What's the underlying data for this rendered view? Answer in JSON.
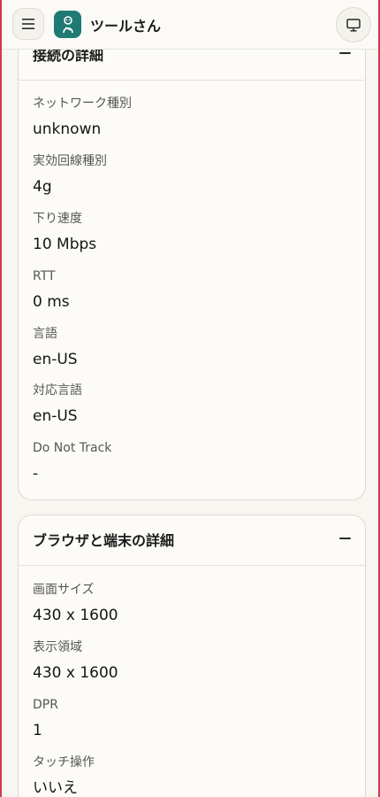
{
  "header": {
    "app_title": "ツールさん"
  },
  "connection_card": {
    "title": "接続の詳細",
    "fields": [
      {
        "label": "ネットワーク種別",
        "value": "unknown"
      },
      {
        "label": "実効回線種別",
        "value": "4g"
      },
      {
        "label": "下り速度",
        "value": "10 Mbps"
      },
      {
        "label": "RTT",
        "value": "0 ms"
      },
      {
        "label": "言語",
        "value": "en-US"
      },
      {
        "label": "対応言語",
        "value": "en-US"
      },
      {
        "label": "Do Not Track",
        "value": "-"
      }
    ]
  },
  "browser_card": {
    "title": "ブラウザと端末の詳細",
    "fields": [
      {
        "label": "画面サイズ",
        "value": "430 x 1600"
      },
      {
        "label": "表示領域",
        "value": "430 x 1600"
      },
      {
        "label": "DPR",
        "value": "1"
      },
      {
        "label": "タッチ操作",
        "value": "いいえ"
      }
    ]
  },
  "colors": {
    "accent_border": "#d23a52",
    "logo_bg": "#1f7a73",
    "background": "#f7f6f1"
  },
  "icons": {
    "menu": "hamburger-menu-icon",
    "logo": "app-logo-icon",
    "display": "monitor-icon",
    "collapse": "minus-icon"
  }
}
